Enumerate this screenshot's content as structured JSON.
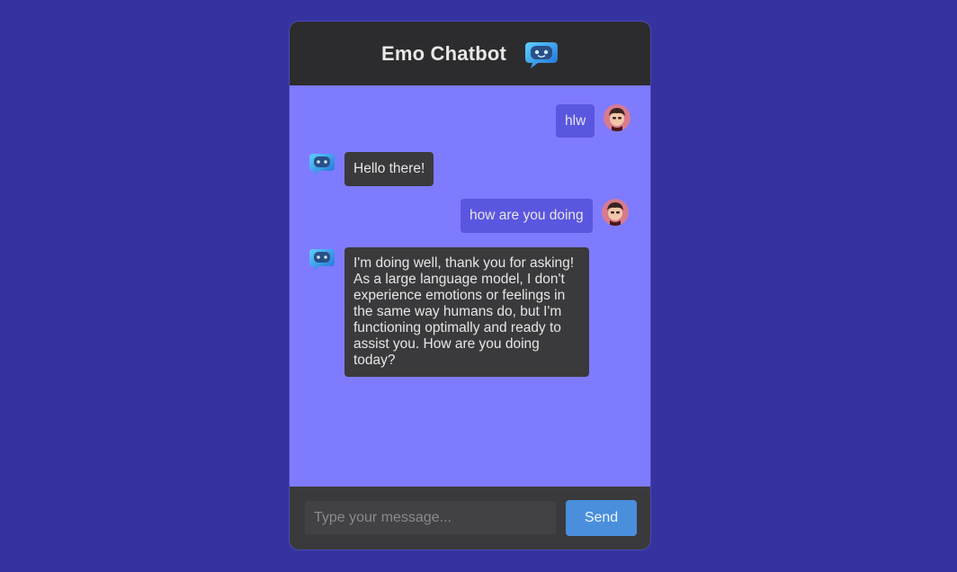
{
  "header": {
    "title": "Emo Chatbot",
    "icon": "robot-chat-icon"
  },
  "messages": [
    {
      "sender": "user",
      "text": "hlw",
      "avatar": "user-avatar-icon"
    },
    {
      "sender": "bot",
      "text": "Hello there!",
      "avatar": "robot-chat-icon"
    },
    {
      "sender": "user",
      "text": "how are you doing",
      "avatar": "user-avatar-icon"
    },
    {
      "sender": "bot",
      "text": "I'm doing well, thank you for asking! As a large language model, I don't experience emotions or feelings in the same way humans do, but I'm functioning optimally and ready to assist you. How are you doing today?",
      "avatar": "robot-chat-icon"
    }
  ],
  "input": {
    "placeholder": "Type your message...",
    "value": ""
  },
  "send_label": "Send",
  "colors": {
    "page_background": "#3633a0",
    "chat_background": "#7f7bff",
    "header_background": "#2c2c2e",
    "user_bubble": "#5a56e0",
    "bot_bubble": "#3a3a3c",
    "send_button": "#4a8fdc"
  }
}
